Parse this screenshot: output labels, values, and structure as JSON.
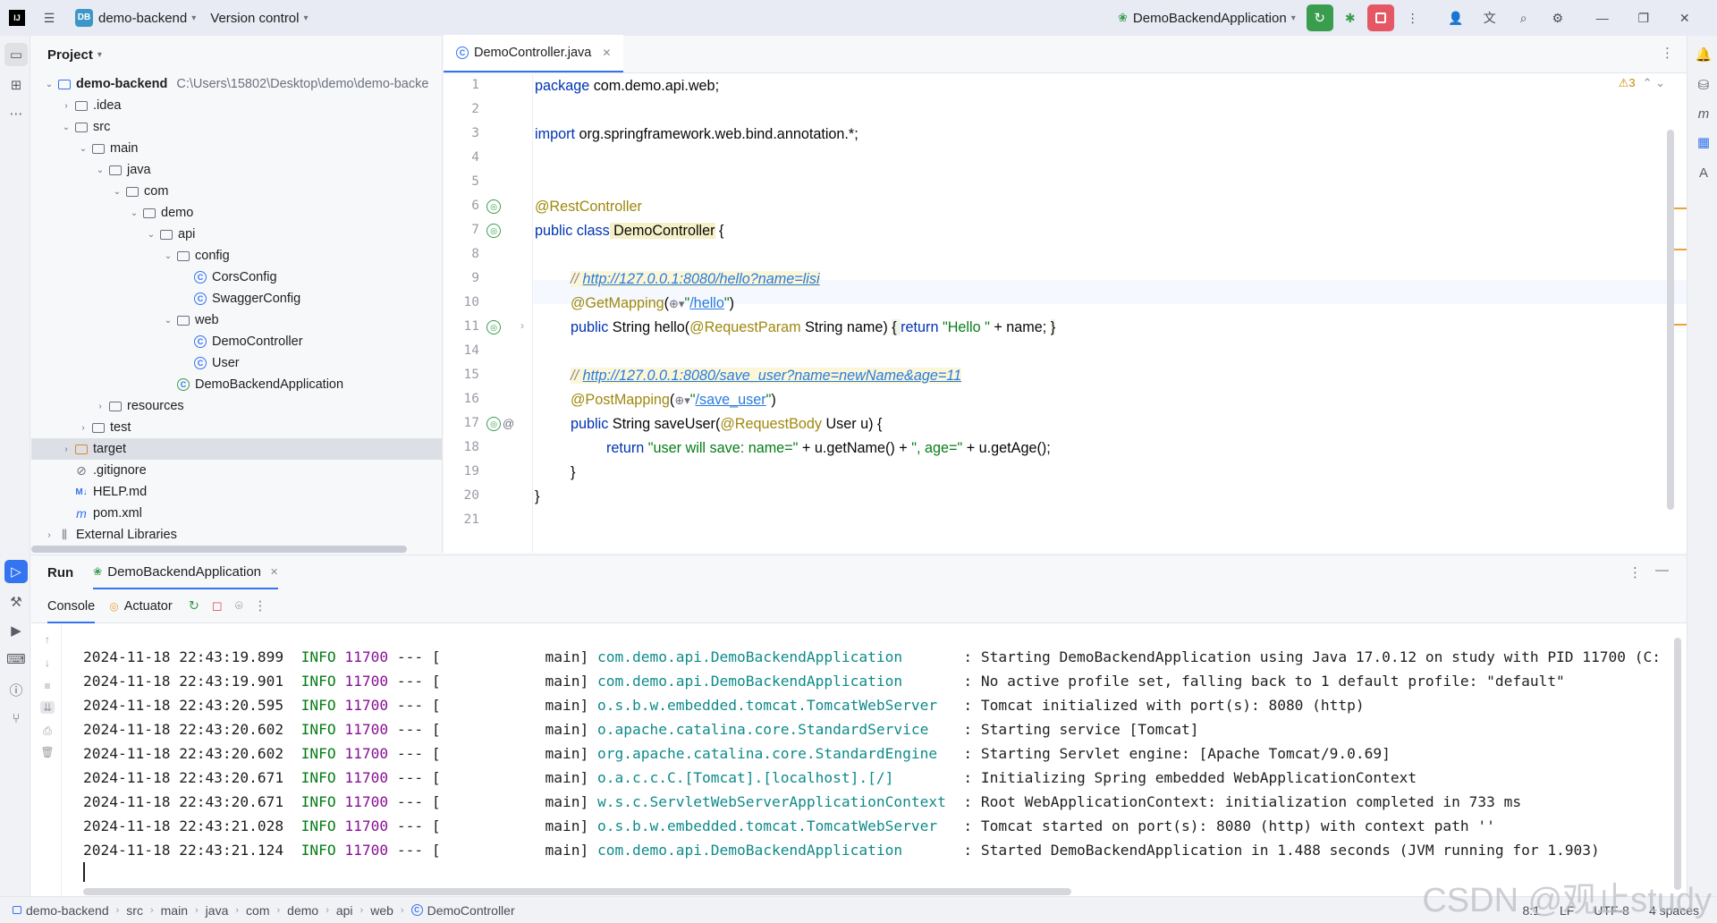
{
  "titlebar": {
    "project_name": "demo-backend",
    "project_badge": "DB",
    "vcs_label": "Version control",
    "run_config": "DemoBackendApplication"
  },
  "project_panel": {
    "title": "Project",
    "tree": [
      {
        "label": "demo-backend",
        "hint": "C:\\Users\\15802\\Desktop\\demo\\demo-backe",
        "depth": 0,
        "arrow": "open",
        "icon": "module"
      },
      {
        "label": ".idea",
        "depth": 1,
        "arrow": "closed",
        "icon": "folder"
      },
      {
        "label": "src",
        "depth": 1,
        "arrow": "open",
        "icon": "folder"
      },
      {
        "label": "main",
        "depth": 2,
        "arrow": "open",
        "icon": "folder"
      },
      {
        "label": "java",
        "depth": 3,
        "arrow": "open",
        "icon": "folder"
      },
      {
        "label": "com",
        "depth": 4,
        "arrow": "open",
        "icon": "package"
      },
      {
        "label": "demo",
        "depth": 5,
        "arrow": "open",
        "icon": "package"
      },
      {
        "label": "api",
        "depth": 6,
        "arrow": "open",
        "icon": "package"
      },
      {
        "label": "config",
        "depth": 7,
        "arrow": "open",
        "icon": "package"
      },
      {
        "label": "CorsConfig",
        "depth": 8,
        "arrow": "none",
        "icon": "class"
      },
      {
        "label": "SwaggerConfig",
        "depth": 8,
        "arrow": "none",
        "icon": "class"
      },
      {
        "label": "web",
        "depth": 7,
        "arrow": "open",
        "icon": "package"
      },
      {
        "label": "DemoController",
        "depth": 8,
        "arrow": "none",
        "icon": "class"
      },
      {
        "label": "User",
        "depth": 8,
        "arrow": "none",
        "icon": "class"
      },
      {
        "label": "DemoBackendApplication",
        "depth": 7,
        "arrow": "none",
        "icon": "spring-class"
      },
      {
        "label": "resources",
        "depth": 3,
        "arrow": "closed",
        "icon": "folder"
      },
      {
        "label": "test",
        "depth": 2,
        "arrow": "closed",
        "icon": "folder"
      },
      {
        "label": "target",
        "depth": 1,
        "arrow": "closed",
        "icon": "folder-orange",
        "selected": true
      },
      {
        "label": ".gitignore",
        "depth": 1,
        "arrow": "none",
        "icon": "ignore"
      },
      {
        "label": "HELP.md",
        "depth": 1,
        "arrow": "none",
        "icon": "markdown"
      },
      {
        "label": "pom.xml",
        "depth": 1,
        "arrow": "none",
        "icon": "maven"
      },
      {
        "label": "External Libraries",
        "depth": 0,
        "arrow": "closed",
        "icon": "library"
      }
    ]
  },
  "editor": {
    "tab_label": "DemoController.java",
    "warnings": "3",
    "line_numbers": [
      "1",
      "2",
      "3",
      "4",
      "5",
      "6",
      "7",
      "8",
      "9",
      "10",
      "11",
      "14",
      "15",
      "16",
      "17",
      "18",
      "19",
      "20",
      "21"
    ],
    "code": {
      "l1_kw": "package",
      "l1_rest": " com.demo.api.web;",
      "l3_kw": "import",
      "l3_rest": " org.springframework.web.bind.annotation.*;",
      "l6_ann": "@RestController",
      "l7_kw": "public class",
      "l7_name": " DemoController",
      "l7_rest": " {",
      "l9_slash": "// ",
      "l9_url": "http://127.0.0.1:8080/hello?name=lisi",
      "l10_ann": "@GetMapping",
      "l10_open": "(",
      "l10_q1": "\"",
      "l10_path": "/hello",
      "l10_q2": "\"",
      "l10_close": ")",
      "l11_kw": "public",
      "l11_a": " String hello(",
      "l11_ann": "@RequestParam",
      "l11_b": " String name) ",
      "l11_brace1": "{ ",
      "l11_kw2": "return",
      "l11_str": " \"Hello \"",
      "l11_c": " + name; ",
      "l11_brace2": "}",
      "l15_slash": "// ",
      "l15_url": "http://127.0.0.1:8080/save_user?name=newName&age=11",
      "l16_ann": "@PostMapping",
      "l16_open": "(",
      "l16_q1": "\"",
      "l16_path": "/save_user",
      "l16_q2": "\"",
      "l16_close": ")",
      "l17_kw": "public",
      "l17_a": " String saveUser(",
      "l17_ann": "@RequestBody",
      "l17_b": " User u) {",
      "l18_kw": "return",
      "l18_str1": " \"user will save: name=\"",
      "l18_a": " + u.getName() + ",
      "l18_str2": "\", age=\"",
      "l18_b": " + u.getAge();",
      "l19": "}",
      "l20": "}"
    }
  },
  "run_panel": {
    "title": "Run",
    "config_tab": "DemoBackendApplication",
    "console_tab": "Console",
    "actuator_tab": "Actuator",
    "logs": [
      {
        "ts": "2024-11-18 22:43:19.899",
        "level": "INFO",
        "pid": "11700",
        "sep": "--- [",
        "thread": "           main]",
        "logger": "com.demo.api.DemoBackendApplication     ",
        "msg": ": Starting DemoBackendApplication using Java 17.0.12 on study with PID 11700 (C:"
      },
      {
        "ts": "2024-11-18 22:43:19.901",
        "level": "INFO",
        "pid": "11700",
        "sep": "--- [",
        "thread": "           main]",
        "logger": "com.demo.api.DemoBackendApplication     ",
        "msg": ": No active profile set, falling back to 1 default profile: \"default\""
      },
      {
        "ts": "2024-11-18 22:43:20.595",
        "level": "INFO",
        "pid": "11700",
        "sep": "--- [",
        "thread": "           main]",
        "logger": "o.s.b.w.embedded.tomcat.TomcatWebServer ",
        "msg": ": Tomcat initialized with port(s): 8080 (http)"
      },
      {
        "ts": "2024-11-18 22:43:20.602",
        "level": "INFO",
        "pid": "11700",
        "sep": "--- [",
        "thread": "           main]",
        "logger": "o.apache.catalina.core.StandardService  ",
        "msg": ": Starting service [Tomcat]"
      },
      {
        "ts": "2024-11-18 22:43:20.602",
        "level": "INFO",
        "pid": "11700",
        "sep": "--- [",
        "thread": "           main]",
        "logger": "org.apache.catalina.core.StandardEngine ",
        "msg": ": Starting Servlet engine: [Apache Tomcat/9.0.69]"
      },
      {
        "ts": "2024-11-18 22:43:20.671",
        "level": "INFO",
        "pid": "11700",
        "sep": "--- [",
        "thread": "           main]",
        "logger": "o.a.c.c.C.[Tomcat].[localhost].[/]      ",
        "msg": ": Initializing Spring embedded WebApplicationContext"
      },
      {
        "ts": "2024-11-18 22:43:20.671",
        "level": "INFO",
        "pid": "11700",
        "sep": "--- [",
        "thread": "           main]",
        "logger": "w.s.c.ServletWebServerApplicationContext",
        "msg": ": Root WebApplicationContext: initialization completed in 733 ms"
      },
      {
        "ts": "2024-11-18 22:43:21.028",
        "level": "INFO",
        "pid": "11700",
        "sep": "--- [",
        "thread": "           main]",
        "logger": "o.s.b.w.embedded.tomcat.TomcatWebServer ",
        "msg": ": Tomcat started on port(s): 8080 (http) with context path ''"
      },
      {
        "ts": "2024-11-18 22:43:21.124",
        "level": "INFO",
        "pid": "11700",
        "sep": "--- [",
        "thread": "           main]",
        "logger": "com.demo.api.DemoBackendApplication     ",
        "msg": ": Started DemoBackendApplication in 1.488 seconds (JVM running for 1.903)"
      }
    ]
  },
  "statusbar": {
    "breadcrumbs": [
      "demo-backend",
      "src",
      "main",
      "java",
      "com",
      "demo",
      "api",
      "web",
      "DemoController"
    ],
    "position": "8:1",
    "line_sep": "LF",
    "encoding": "UTF-8",
    "indent": "4 spaces"
  },
  "watermark": "CSDN @观止study",
  "colors": {
    "accent": "#3574f0",
    "run_green": "#3a9d4e",
    "stop_red": "#e55765"
  }
}
